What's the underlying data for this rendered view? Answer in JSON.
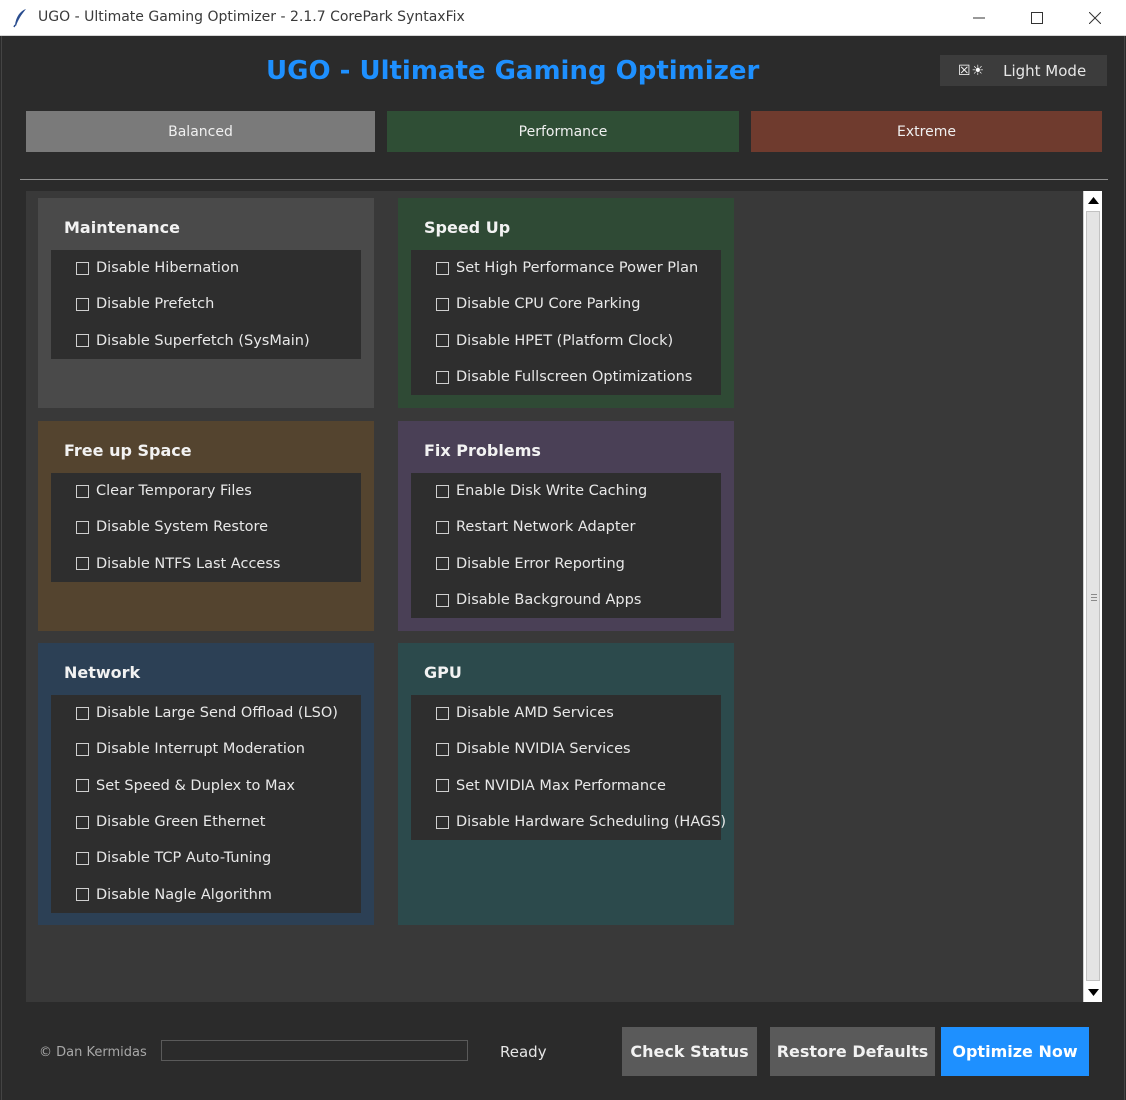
{
  "window": {
    "title": "UGO - Ultimate Gaming Optimizer - 2.1.7 CorePark SyntaxFix"
  },
  "header": {
    "title": "UGO - Ultimate Gaming Optimizer",
    "theme_toggle_icon": "☒☀",
    "theme_toggle_label": "Light Mode"
  },
  "presets": {
    "balanced": "Balanced",
    "performance": "Performance",
    "extreme": "Extreme"
  },
  "panels": {
    "maintenance": {
      "title": "Maintenance",
      "items": [
        "Disable Hibernation",
        "Disable Prefetch",
        "Disable Superfetch (SysMain)"
      ]
    },
    "speed_up": {
      "title": "Speed Up",
      "items": [
        "Set High Performance Power Plan",
        "Disable CPU Core Parking",
        "Disable HPET (Platform Clock)",
        "Disable Fullscreen Optimizations"
      ]
    },
    "free_space": {
      "title": "Free up Space",
      "items": [
        "Clear Temporary Files",
        "Disable System Restore",
        "Disable NTFS Last Access"
      ]
    },
    "fix_problems": {
      "title": "Fix Problems",
      "items": [
        "Enable Disk Write Caching",
        "Restart Network Adapter",
        "Disable Error Reporting",
        "Disable Background Apps"
      ]
    },
    "network": {
      "title": "Network",
      "items": [
        "Disable Large Send Offload (LSO)",
        "Disable Interrupt Moderation",
        "Set Speed & Duplex to Max",
        "Disable Green Ethernet",
        "Disable TCP Auto-Tuning",
        "Disable Nagle Algorithm"
      ]
    },
    "gpu": {
      "title": "GPU",
      "items": [
        "Disable AMD Services",
        "Disable NVIDIA Services",
        "Set NVIDIA Max Performance",
        "Disable Hardware Scheduling (HAGS)"
      ]
    }
  },
  "footer": {
    "copyright": "© Dan Kermidas",
    "progress": 0,
    "status": "Ready",
    "check_status": "Check Status",
    "restore_defaults": "Restore Defaults",
    "optimize_now": "Optimize Now"
  },
  "colors": {
    "accent": "#1e90ff",
    "balanced": "#7a7a7a",
    "performance": "#2f4e35",
    "extreme": "#6f3b2e"
  }
}
